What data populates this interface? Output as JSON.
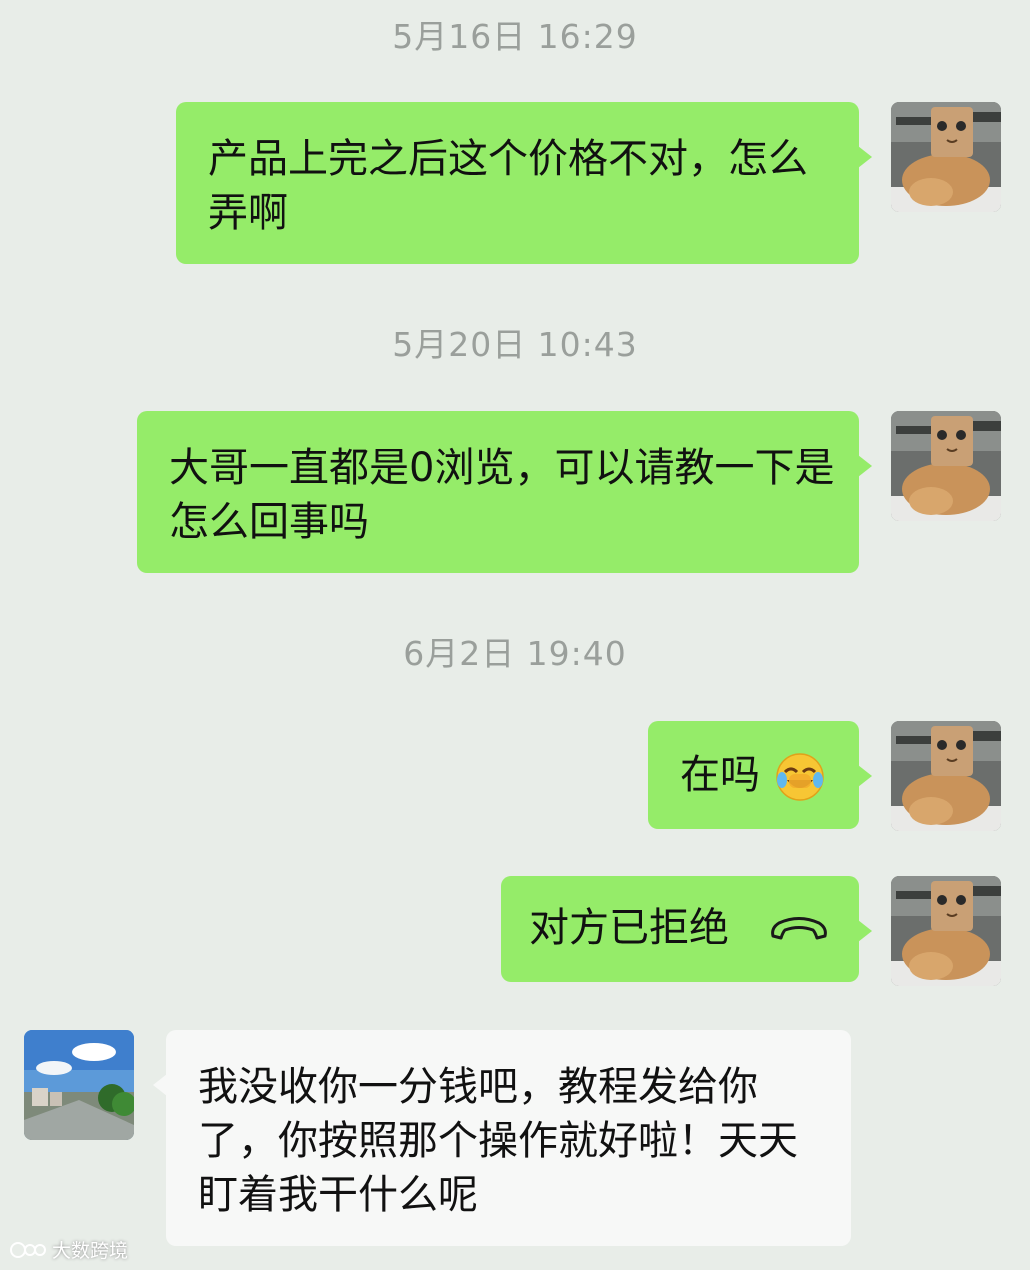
{
  "timestamps": [
    "5月16日 16:29",
    "5月20日 10:43",
    "6月2日 19:40"
  ],
  "messages": [
    {
      "from": "me",
      "text": "产品上完之后这个价格不对，怎么弄啊"
    },
    {
      "from": "me",
      "text": "大哥一直都是0浏览，可以请教一下是怎么回事吗"
    },
    {
      "from": "me",
      "text": "在吗",
      "emoji": "face-with-tears-of-joy-icon"
    },
    {
      "from": "me",
      "text": "对方已拒绝",
      "icon": "phone-hangup-icon"
    },
    {
      "from": "other",
      "text": "我没收你一分钱吧，教程发给你了，你按照那个操作就好啦！天天盯着我干什么呢"
    }
  ],
  "watermark": "大数跨境",
  "colors": {
    "background": "#e8ede8",
    "my_bubble": "#95ec69",
    "their_bubble": "#f7f8f7",
    "timestamp": "#9a9f9b"
  }
}
